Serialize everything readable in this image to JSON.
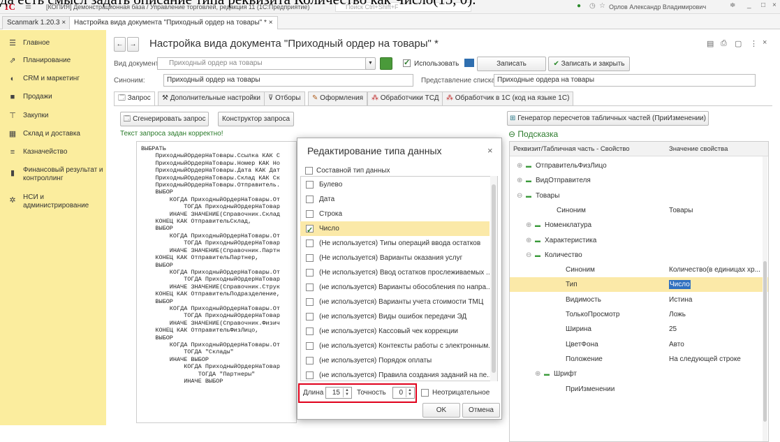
{
  "caption": "да есть смысл задать описание типа реквизита Количество как Число(15, 0).",
  "titlebar": {
    "logo": "1C",
    "title": "[КОПИЯ] Демонстрационная база / Управление торговлей, редакция 11 (1С:Предприятие)",
    "search_placeholder": "Поиск Ctrl+Shift+F",
    "user": "Орлов Александр Владимирович"
  },
  "window_tabs": [
    "Scanmark 1.20.3",
    "Настройка вида документа \"Приходный ордер на товары\" *"
  ],
  "sidebar": {
    "items": [
      {
        "label": "Главное",
        "icon": "menu-icon"
      },
      {
        "label": "Планирование",
        "icon": "chart-icon"
      },
      {
        "label": "CRM и маркетинг",
        "icon": "crm-icon"
      },
      {
        "label": "Продажи",
        "icon": "bag-icon"
      },
      {
        "label": "Закупки",
        "icon": "cart-icon"
      },
      {
        "label": "Склад и доставка",
        "icon": "warehouse-icon"
      },
      {
        "label": "Казначейство",
        "icon": "treasury-icon"
      },
      {
        "label": "Финансовый результат и контроллинг",
        "icon": "finance-icon"
      },
      {
        "label": "НСИ и администрирование",
        "icon": "gear-icon"
      }
    ]
  },
  "form": {
    "title": "Настройка вида документа \"Приходный ордер на товары\" *",
    "doc_label": "Вид документа:",
    "doc_value": "Приходный ордер на товары",
    "use_label": "Использовать",
    "save": "Записать",
    "save_close": "Записать и закрыть",
    "synonym_label": "Синоним:",
    "synonym_value": "Приходный ордер на товары",
    "list_label": "Представление списка:",
    "list_value": "Приходные ордера на товары",
    "tabs": [
      "Запрос",
      "Дополнительные настройки",
      "Отборы",
      "Оформления",
      "Обработчики ТСД",
      "Обработчик в 1С (код на языке 1С)"
    ],
    "gen_query": "Сгенерировать запрос",
    "constructor": "Конструктор запроса",
    "query_ok": "Текст запроса задан корректно!",
    "generator": "Генератор пересчетов табличных частей (ПриИзменении)",
    "hint": "Подсказка",
    "code": "ВЫБРАТЬ\n    ПриходныйОрдерНаТовары.Ссылка КАК С\n    ПриходныйОрдерНаТовары.Номер КАК Но\n    ПриходныйОрдерНаТовары.Дата КАК Дат\n    ПриходныйОрдерНаТовары.Склад КАК Ск\n    ПриходныйОрдерНаТовары.Отправитель.\n    ВЫБОР\n        КОГДА ПриходныйОрдерНаТовары.От\n            ТОГДА ПриходныйОрдерНаТовар\n        ИНАЧЕ ЗНАЧЕНИЕ(Справочник.Склад\n    КОНЕЦ КАК ОтправительСклад,\n    ВЫБОР\n        КОГДА ПриходныйОрдерНаТовары.От\n            ТОГДА ПриходныйОрдерНаТовар\n        ИНАЧЕ ЗНАЧЕНИЕ(Справочник.Партн\n    КОНЕЦ КАК ОтправительПартнер,\n    ВЫБОР\n        КОГДА ПриходныйОрдерНаТовары.От\n            ТОГДА ПриходныйОрдерНаТовар\n        ИНАЧЕ ЗНАЧЕНИЕ(Справочник.Струк\n    КОНЕЦ КАК ОтправительПодразделение,\n    ВЫБОР\n        КОГДА ПриходныйОрдерНаТовары.От\n            ТОГДА ПриходныйОрдерНаТовар\n        ИНАЧЕ ЗНАЧЕНИЕ(Справочник.Физич\n    КОНЕЦ КАК ОтправительФизЛицо,\n    ВЫБОР\n        КОГДА ПриходныйОрдерНаТовары.От\n            ТОГДА \"Склады\"\n        ИНАЧЕ ВЫБОР\n            КОГДА ПриходныйОрдерНаТовар\n                ТОГДА \"Партнеры\"\n            ИНАЧЕ ВЫБОР"
  },
  "props": {
    "col1": "Реквизит/Табличная часть - Свойство",
    "col2": "Значение свойства",
    "rows": [
      {
        "k": "ОтправительФизЛицо",
        "v": "",
        "lvl": 0,
        "exp": "⊕"
      },
      {
        "k": "ВидОтправителя",
        "v": "",
        "lvl": 0,
        "exp": "⊕"
      },
      {
        "k": "Товары",
        "v": "",
        "lvl": 0,
        "exp": "⊖"
      },
      {
        "k": "Синоним",
        "v": "Товары",
        "lvl": 1,
        "exp": ""
      },
      {
        "k": "Номенклатура",
        "v": "",
        "lvl": 1,
        "exp": "⊕"
      },
      {
        "k": "Характеристика",
        "v": "",
        "lvl": 1,
        "exp": "⊕"
      },
      {
        "k": "Количество",
        "v": "",
        "lvl": 1,
        "exp": "⊖"
      },
      {
        "k": "Синоним",
        "v": "Количество(в единицах хр...",
        "lvl": 2,
        "exp": ""
      },
      {
        "k": "Тип",
        "v": "Число",
        "lvl": 2,
        "exp": ""
      },
      {
        "k": "Видимость",
        "v": "Истина",
        "lvl": 2,
        "exp": ""
      },
      {
        "k": "ТолькоПросмотр",
        "v": "Ложь",
        "lvl": 2,
        "exp": ""
      },
      {
        "k": "Ширина",
        "v": "25",
        "lvl": 2,
        "exp": ""
      },
      {
        "k": "ЦветФона",
        "v": "Авто",
        "lvl": 2,
        "exp": ""
      },
      {
        "k": "Положение",
        "v": "На следующей строке",
        "lvl": 2,
        "exp": ""
      },
      {
        "k": "Шрифт",
        "v": "",
        "lvl": 2,
        "exp": "⊕"
      },
      {
        "k": "ПриИзменении",
        "v": "",
        "lvl": 2,
        "exp": ""
      }
    ]
  },
  "dialog": {
    "title": "Редактирование типа данных",
    "composite": "Составной тип данных",
    "items": [
      {
        "t": "Булево",
        "on": false
      },
      {
        "t": "Дата",
        "on": false
      },
      {
        "t": "Строка",
        "on": false
      },
      {
        "t": "Число",
        "on": true
      },
      {
        "t": "(Не используется)  Типы операций ввода остатков",
        "on": false
      },
      {
        "t": "(Не используется) Варианты оказания услуг",
        "on": false
      },
      {
        "t": "(Не используется) Ввод остатков прослеживаемых ...",
        "on": false
      },
      {
        "t": "(не используется) Варианты обособления по напра...",
        "on": false
      },
      {
        "t": "(не используется) Варианты учета стоимости ТМЦ",
        "on": false
      },
      {
        "t": "(не используется) Виды ошибок передачи ЭД",
        "on": false
      },
      {
        "t": "(не используется) Кассовый чек коррекции",
        "on": false
      },
      {
        "t": "(не используется) Контексты работы с электронным...",
        "on": false
      },
      {
        "t": "(не используется) Порядок оплаты",
        "on": false
      },
      {
        "t": "(не используется) Правила создания заданий на пе...",
        "on": false
      }
    ],
    "length_label": "Длина",
    "length": "15",
    "precision_label": "Точность",
    "precision": "0",
    "nonneg": "Неотрицательное",
    "ok": "OK",
    "cancel": "Отмена"
  }
}
